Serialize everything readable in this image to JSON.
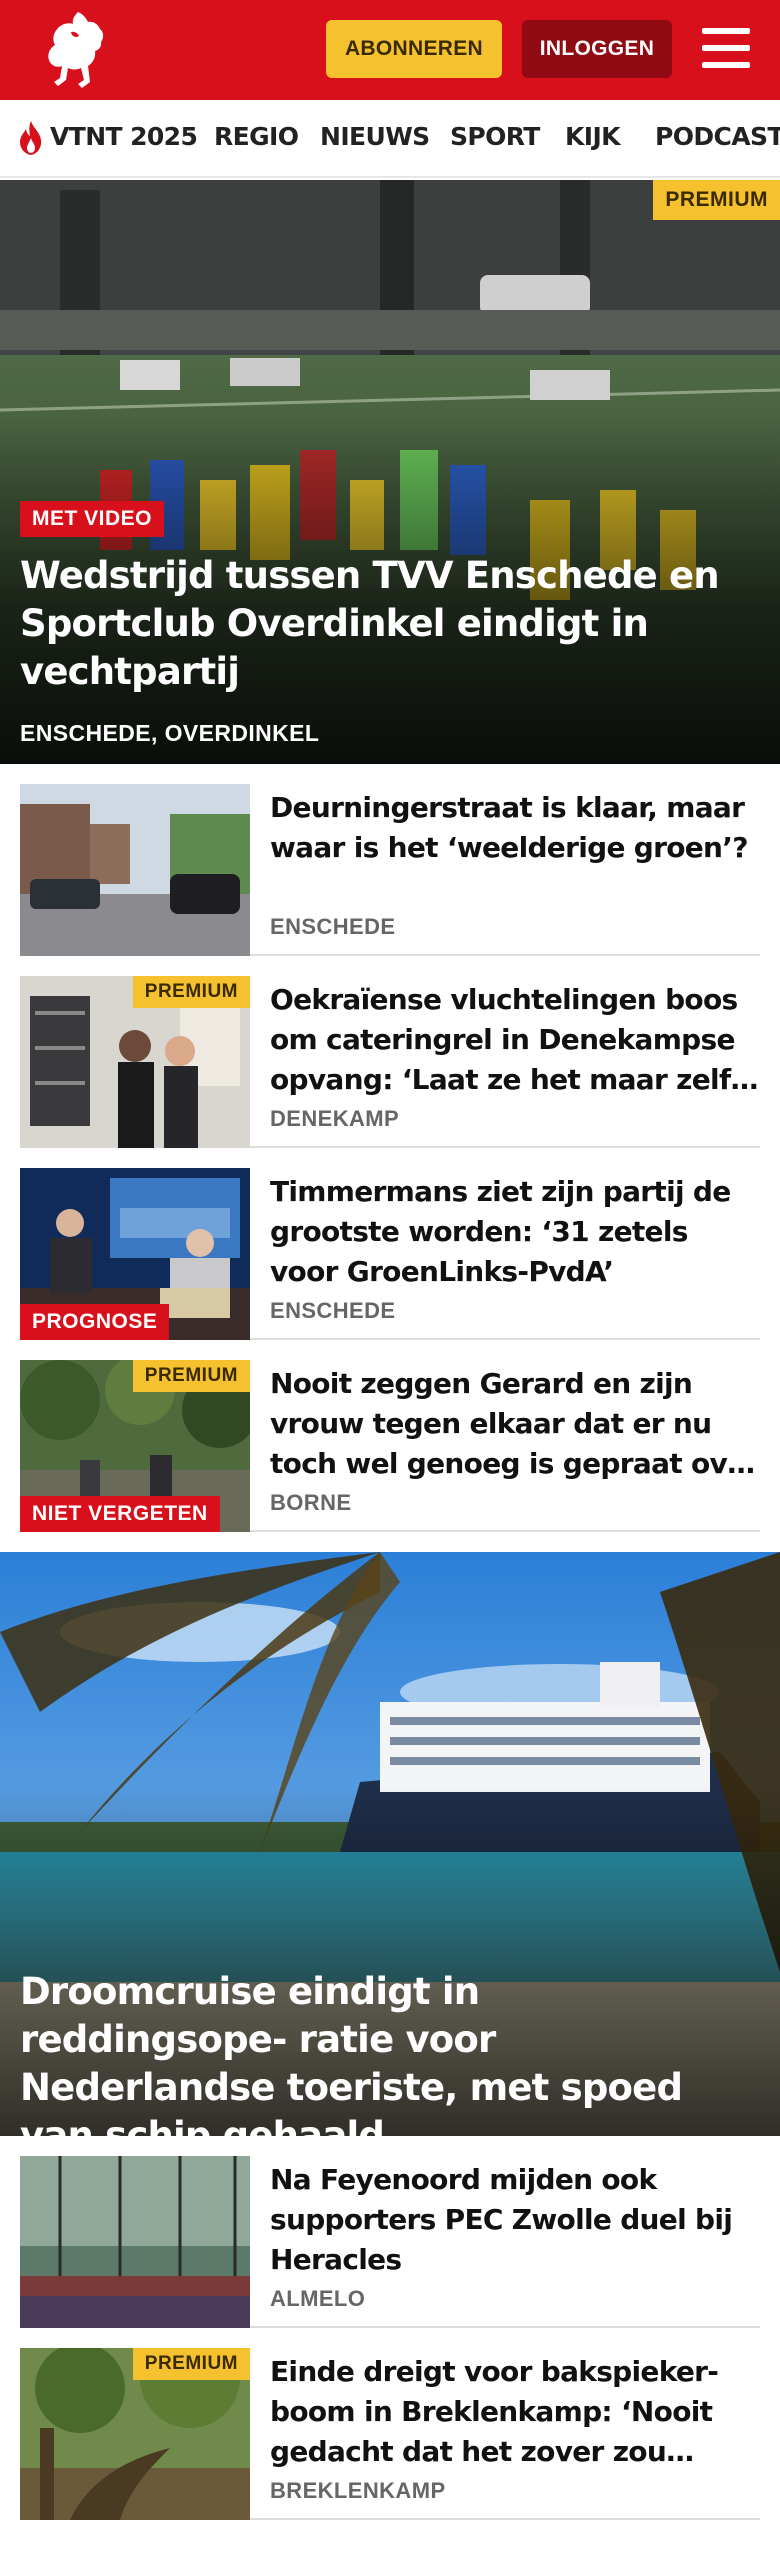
{
  "header": {
    "logo_icon": "twente-horse-logo-icon",
    "subscribe_label": "ABONNEREN",
    "login_label": "INLOGGEN",
    "menu_icon": "hamburger-menu-icon",
    "colors": {
      "brand_red": "#d8101b",
      "subscribe_yellow": "#f5c12e",
      "login_dark_red": "#8f0a12"
    }
  },
  "nav": {
    "items": [
      {
        "label": "VTNT 2025",
        "icon": "flame-icon"
      },
      {
        "label": "REGIO"
      },
      {
        "label": "NIEUWS"
      },
      {
        "label": "SPORT"
      },
      {
        "label": "KIJK"
      },
      {
        "label": "PODCAST"
      }
    ]
  },
  "hero1": {
    "premium": "PREMIUM",
    "badge": "MET VIDEO",
    "title": "Wedstrijd tussen TVV Enschede en Sportclub Overdinkel eindigt in vechtpartij",
    "location": "ENSCHEDE, OVERDINKEL"
  },
  "articles1": [
    {
      "title": "Deurningerstraat is klaar, maar waar is het ‘weelderige groen’?",
      "location": "ENSCHEDE"
    },
    {
      "premium": "PREMIUM",
      "title": "Oekraïense vluchtelingen boos om cateringrel in Denekampse opvang: ‘Laat ze het maar zelf doen’",
      "location": "DENEKAMP"
    },
    {
      "badge": "PROGNOSE",
      "title": "Timmermans ziet zijn partij de grootste worden: ‘31 zetels voor GroenLinks-PvdA’",
      "location": "ENSCHEDE"
    },
    {
      "premium": "PREMIUM",
      "badge": "NIET VERGETEN",
      "title": "Nooit zeggen Gerard en zijn vrouw tegen elkaar dat er nu toch wel genoeg is gepraat over hun zoon",
      "location": "BORNE"
    }
  ],
  "hero2": {
    "title": "Droomcruise eindigt in reddingsope- ratie voor Nederlandse toeriste, met spoed van schip gehaald"
  },
  "articles2": [
    {
      "title": "Na Feyenoord mijden ook supporters PEC Zwolle duel bij Heracles",
      "location": "ALMELO"
    },
    {
      "premium": "PREMIUM",
      "title": "Einde dreigt voor bakspieker- boom in Breklenkamp: ‘Nooit gedacht dat het zover zou komen’",
      "location": "BREKLENKAMP"
    }
  ]
}
